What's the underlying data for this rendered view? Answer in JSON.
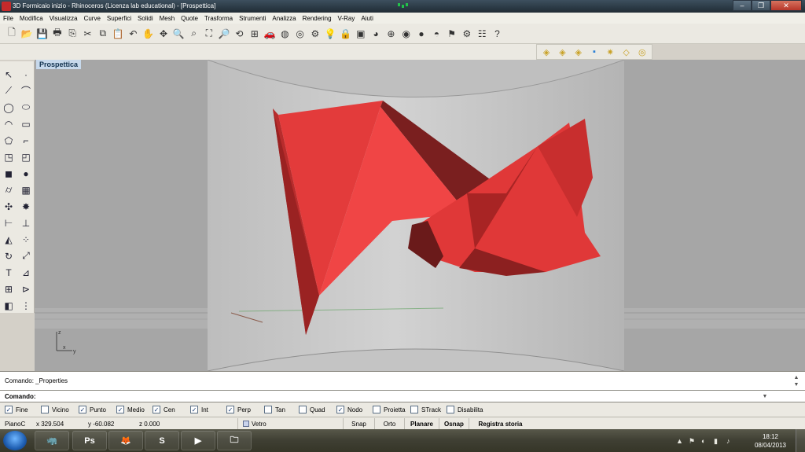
{
  "window": {
    "title": "3D Formicaio inizio  - Rhinoceros (Licenza lab educational) - [Prospettica]",
    "minimize": "–",
    "maximize": "❐",
    "close": "✕"
  },
  "menu": [
    "File",
    "Modifica",
    "Visualizza",
    "Curve",
    "Superfici",
    "Solidi",
    "Mesh",
    "Quote",
    "Trasforma",
    "Strumenti",
    "Analizza",
    "Rendering",
    "V-Ray",
    "Aiuti"
  ],
  "toolbar_main": [
    {
      "icon": "new-file-icon",
      "glyph": "🗋"
    },
    {
      "icon": "open-folder-icon",
      "glyph": "📂"
    },
    {
      "icon": "save-icon",
      "glyph": "💾"
    },
    {
      "icon": "print-icon",
      "glyph": "🖶"
    },
    {
      "icon": "import-icon",
      "glyph": "⎘"
    },
    {
      "icon": "cut-icon",
      "glyph": "✂"
    },
    {
      "icon": "copy-icon",
      "glyph": "⧉"
    },
    {
      "icon": "paste-icon",
      "glyph": "📋"
    },
    {
      "icon": "undo-icon",
      "glyph": "↶"
    },
    {
      "icon": "pan-hand-icon",
      "glyph": "✋"
    },
    {
      "icon": "rotate-view-icon",
      "glyph": "✥"
    },
    {
      "icon": "zoom-icon",
      "glyph": "🔍"
    },
    {
      "icon": "zoom-window-icon",
      "glyph": "⌕"
    },
    {
      "icon": "zoom-extents-icon",
      "glyph": "⛶"
    },
    {
      "icon": "zoom-selected-icon",
      "glyph": "🔎"
    },
    {
      "icon": "rotate-view-3d-icon",
      "glyph": "⟲"
    },
    {
      "icon": "four-viewports-icon",
      "glyph": "⊞"
    },
    {
      "icon": "car-icon",
      "glyph": "🚗"
    },
    {
      "icon": "render-preview-icon",
      "glyph": "◍"
    },
    {
      "icon": "select-filter-icon",
      "glyph": "◎"
    },
    {
      "icon": "osnap-icon",
      "glyph": "⚙"
    },
    {
      "icon": "lightbulb-icon",
      "glyph": "💡"
    },
    {
      "icon": "lock-icon",
      "glyph": "🔒"
    },
    {
      "icon": "material-icon",
      "glyph": "▣"
    },
    {
      "icon": "color-wheel-icon",
      "glyph": "◕"
    },
    {
      "icon": "wireframe-sphere-icon",
      "glyph": "⊕"
    },
    {
      "icon": "shaded-sphere-icon",
      "glyph": "◉"
    },
    {
      "icon": "rendered-sphere-icon",
      "glyph": "●"
    },
    {
      "icon": "ghosted-icon",
      "glyph": "◓"
    },
    {
      "icon": "pointer-flag-icon",
      "glyph": "⚑"
    },
    {
      "icon": "options-gear-icon",
      "glyph": "⚙"
    },
    {
      "icon": "properties-icon",
      "glyph": "☷"
    },
    {
      "icon": "help-icon",
      "glyph": "?"
    }
  ],
  "toolbar_vray": [
    {
      "icon": "vray-tag-icon",
      "glyph": "◈"
    },
    {
      "icon": "vray-tag-2-icon",
      "glyph": "◈"
    },
    {
      "icon": "vray-tag-3-icon",
      "glyph": "◈"
    },
    {
      "icon": "vray-cube-icon",
      "glyph": "▪"
    },
    {
      "icon": "vray-sun-icon",
      "glyph": "✷"
    },
    {
      "icon": "vray-tag-4-icon",
      "glyph": "◇"
    },
    {
      "icon": "vray-options-icon",
      "glyph": "◎"
    }
  ],
  "left_tools": [
    {
      "icon": "select-arrow-icon",
      "glyph": "↖"
    },
    {
      "icon": "point-icon",
      "glyph": "·"
    },
    {
      "icon": "polyline-icon",
      "glyph": "⟋"
    },
    {
      "icon": "curve-icon",
      "glyph": "⌒"
    },
    {
      "icon": "circle-icon",
      "glyph": "◯"
    },
    {
      "icon": "ellipse-icon",
      "glyph": "⬭"
    },
    {
      "icon": "arc-icon",
      "glyph": "◠"
    },
    {
      "icon": "rectangle-icon",
      "glyph": "▭"
    },
    {
      "icon": "polygon-icon",
      "glyph": "⬠"
    },
    {
      "icon": "fillet-icon",
      "glyph": "⌐"
    },
    {
      "icon": "surface-icon",
      "glyph": "◳"
    },
    {
      "icon": "loft-icon",
      "glyph": "◰"
    },
    {
      "icon": "box-icon",
      "glyph": "◼"
    },
    {
      "icon": "sphere-solid-icon",
      "glyph": "●"
    },
    {
      "icon": "cylinder-icon",
      "glyph": "⌭"
    },
    {
      "icon": "mesh-icon",
      "glyph": "▦"
    },
    {
      "icon": "boolean-icon",
      "glyph": "✣"
    },
    {
      "icon": "explode-icon",
      "glyph": "✸"
    },
    {
      "icon": "trim-icon",
      "glyph": "⊢"
    },
    {
      "icon": "split-icon",
      "glyph": "⊥"
    },
    {
      "icon": "group-icon",
      "glyph": "◭"
    },
    {
      "icon": "points-on-icon",
      "glyph": "⁘"
    },
    {
      "icon": "rotate-icon",
      "glyph": "↻"
    },
    {
      "icon": "scale-icon",
      "glyph": "⤢"
    },
    {
      "icon": "text-icon",
      "glyph": "T"
    },
    {
      "icon": "dimension-icon",
      "glyph": "⊿"
    },
    {
      "icon": "array-icon",
      "glyph": "⊞"
    },
    {
      "icon": "project-icon",
      "glyph": "⊳"
    },
    {
      "icon": "render-cube-icon",
      "glyph": "◧"
    },
    {
      "icon": "grid-icon",
      "glyph": "⋮"
    }
  ],
  "viewport": {
    "label": "Prospettica",
    "axis_z": "z",
    "axis_x": "x",
    "axis_y": "y",
    "background": "#a6a6a6",
    "object_color": "#e03838"
  },
  "command": {
    "history": "Comando: _Properties",
    "prompt": "Comando:",
    "input_value": ""
  },
  "osnaps": [
    {
      "label": "Fine",
      "checked": true
    },
    {
      "label": "Vicino",
      "checked": false
    },
    {
      "label": "Punto",
      "checked": true
    },
    {
      "label": "Medio",
      "checked": true
    },
    {
      "label": "Cen",
      "checked": true
    },
    {
      "label": "Int",
      "checked": true
    },
    {
      "label": "Perp",
      "checked": true
    },
    {
      "label": "Tan",
      "checked": false
    },
    {
      "label": "Quad",
      "checked": false
    },
    {
      "label": "Nodo",
      "checked": true
    },
    {
      "label": "Proietta",
      "checked": false
    },
    {
      "label": "STrack",
      "checked": false
    },
    {
      "label": "Disabilita",
      "checked": false
    }
  ],
  "status": {
    "plane": "PianoC",
    "x": "x 329.504",
    "y": "y -60.082",
    "z": "z 0.000",
    "layer": "Vetro",
    "snap": "Snap",
    "ortho": "Orto",
    "planar": "Planare",
    "osnap": "Osnap",
    "history": "Registra storia"
  },
  "taskbar": {
    "apps": [
      {
        "icon": "rhino-app-icon",
        "glyph": "🦏"
      },
      {
        "icon": "photoshop-app-icon",
        "glyph": "Ps"
      },
      {
        "icon": "firefox-app-icon",
        "glyph": "🦊"
      },
      {
        "icon": "skype-app-icon",
        "glyph": "S"
      },
      {
        "icon": "media-app-icon",
        "glyph": "▶"
      },
      {
        "icon": "explorer-app-icon",
        "glyph": "🗀"
      }
    ],
    "time": "18:12",
    "date": "08/04/2013"
  }
}
